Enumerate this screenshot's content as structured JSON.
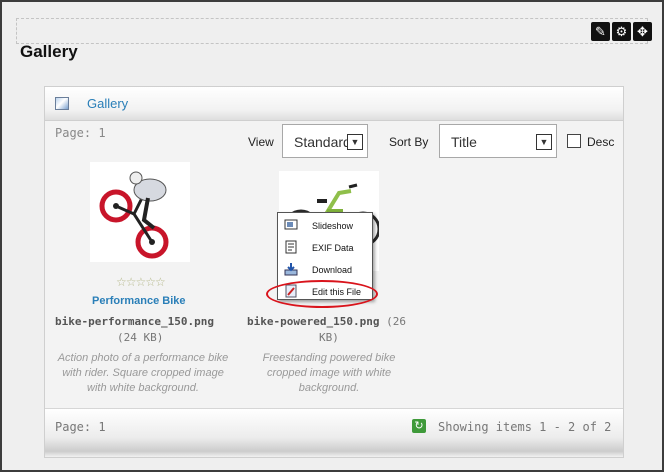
{
  "toolbar": {
    "edit_icon": "pencil-icon",
    "settings_icon": "gear-icon",
    "move_icon": "move-arrows-icon"
  },
  "page": {
    "heading": "Gallery"
  },
  "panel": {
    "header_link": "Gallery",
    "page_label_top": "Page: 1",
    "view_label": "View",
    "view_value": "Standard",
    "sort_label": "Sort By",
    "sort_value": "Title",
    "desc_label": "Desc",
    "desc_checked": false
  },
  "items": [
    {
      "title": "Performance Bike",
      "rating": "☆☆☆☆☆",
      "filename": "bike-performance_150.png",
      "size": "(24 KB)",
      "description": "Action photo of a performance bike with rider. Square cropped image with white background."
    },
    {
      "title": "",
      "filename": "bike-powered_150.png",
      "size_a": "(26",
      "size_b": "KB)",
      "description": "Freestanding powered bike cropped image with white background."
    }
  ],
  "context_menu": {
    "items": [
      {
        "label": "Slideshow",
        "icon": "slideshow-icon"
      },
      {
        "label": "EXIF Data",
        "icon": "exif-data-icon"
      },
      {
        "label": "Download",
        "icon": "download-icon"
      },
      {
        "label": "Edit this File",
        "icon": "edit-file-icon"
      }
    ]
  },
  "footer": {
    "page_label": "Page: 1",
    "showing": "Showing items 1 - 2 of 2"
  }
}
